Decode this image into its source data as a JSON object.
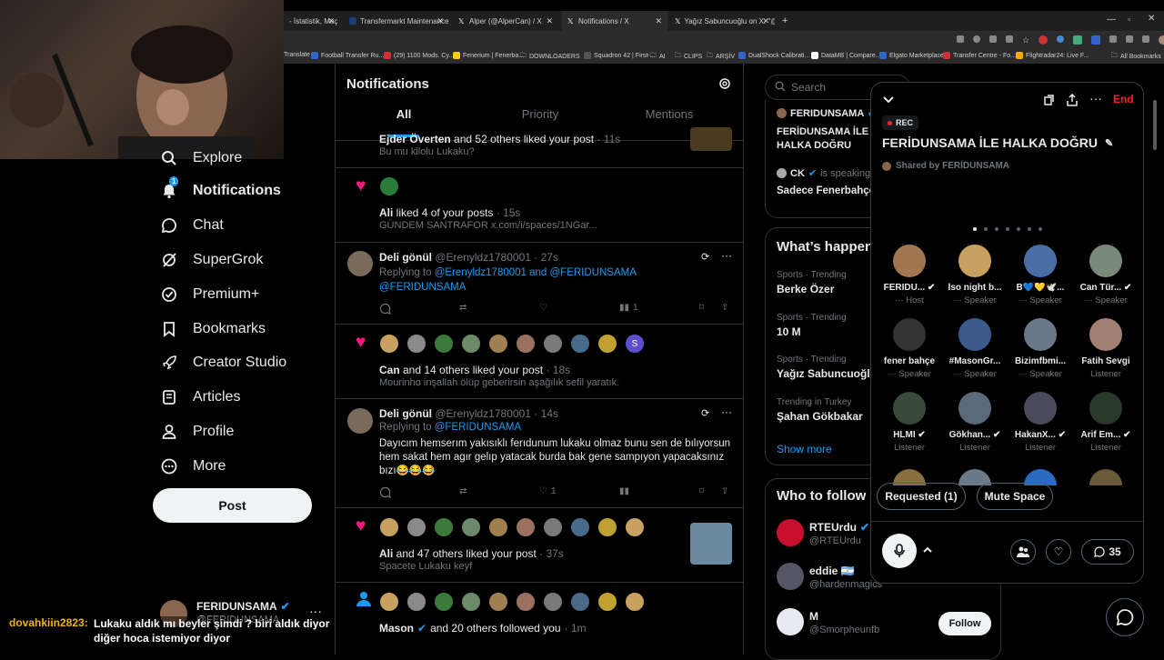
{
  "browser": {
    "tabs": [
      {
        "label": "- İstatistik, Maç",
        "color": "#e44"
      },
      {
        "label": "Transfermarkt Maintenance",
        "color": "#1a3d7c"
      },
      {
        "label": "Alper (@AlperCan) / X",
        "color": "#fff"
      },
      {
        "label": "Notifications / X",
        "color": "#fff"
      },
      {
        "label": "Yağız Sabuncuoğlu on X: \"@Be",
        "color": "#fff"
      }
    ],
    "bookmarks": [
      "Translate",
      "Football Transfer Ru...",
      "(29) 1100 Mods. Cy...",
      "Fenerium | Fenerba...",
      "DOWNLOADERS",
      "Squadron 42 | First-...",
      "AI",
      "CLIPS",
      "ARŞİV",
      "DualShock Calibrati...",
      "DataMB | Compare...",
      "Elgato Marketplace",
      "Transfer Centre - Fo...",
      "Flightradar24: Live F...",
      "All Bookmarks"
    ]
  },
  "nav": {
    "items": [
      {
        "label": "Explore",
        "icon": "search-icon"
      },
      {
        "label": "Notifications",
        "icon": "bell-icon",
        "badge": "1"
      },
      {
        "label": "Chat",
        "icon": "chat-icon"
      },
      {
        "label": "SuperGrok",
        "icon": "grok-icon"
      },
      {
        "label": "Premium+",
        "icon": "premium-icon"
      },
      {
        "label": "Bookmarks",
        "icon": "bookmark-icon"
      },
      {
        "label": "Creator Studio",
        "icon": "rocket-icon"
      },
      {
        "label": "Articles",
        "icon": "articles-icon"
      },
      {
        "label": "Profile",
        "icon": "person-icon"
      },
      {
        "label": "More",
        "icon": "more-icon"
      }
    ],
    "post": "Post",
    "account_name": "FERIDUNSAMA",
    "account_handle": "@FERIDUNSAMA"
  },
  "header": {
    "title": "Notifications",
    "tabs": [
      "All",
      "Priority",
      "Mentions"
    ]
  },
  "notifications": [
    {
      "type": "like",
      "actor": "Ejder Överten",
      "text": " and 52 others liked your post",
      "time": " · 11s",
      "body": "Bu mu kilolu Lukaku?"
    },
    {
      "type": "like",
      "actor": "Ali",
      "text": " liked 4 of your posts",
      "time": " · 15s",
      "body": "GÜNDEM SANTRAFOR x.com/i/spaces/1NGar..."
    },
    {
      "type": "reply",
      "name": "Deli gönül",
      "handle": "@Erenyldz1780001",
      "time": " · 27s",
      "replying": "Replying to ",
      "reply_to": "@Erenyldz1780001 and @FERIDUNSAMA",
      "reply_to2": "@FERIDUNSAMA",
      "views": "1"
    },
    {
      "type": "like",
      "actor": "Can",
      "text": " and 14 others liked your post",
      "time": " · 18s",
      "body": "Mourinho inşallah ölüp geberirsin aşağılık sefil yaratık.",
      "avatar_letter": "S"
    },
    {
      "type": "reply",
      "name": "Deli gönül",
      "handle": "@Erenyldz1780001",
      "time": " · 14s",
      "replying": "Replying to ",
      "reply_to": "@FERIDUNSAMA",
      "body": "Dayıcım hemserım yakısıklı ferıdunum lukaku olmaz bunu sen de bılıyorsun hem sakat hem agır gelıp yatacak burda bak gene sampıyon yapacaksınız bızı😂😂😂",
      "likes": "1"
    },
    {
      "type": "like",
      "actor": "Ali",
      "text": " and 47 others liked your post",
      "time": " · 37s",
      "body": "Spacete Lukaku keyf"
    },
    {
      "type": "follow",
      "actor": "Mason",
      "text": " and 20 others followed you",
      "time": " · 1m"
    }
  ],
  "right": {
    "search_placeholder": "Search",
    "space_card": {
      "host": "FERIDUNSAMA",
      "title": "FERİDUNSAMA İLE HALKA DOĞRU",
      "speaker": "CK",
      "speaking": "is speaking",
      "speaker_title": "Sadece Fenerbahçe"
    },
    "trends_title": "What’s happening",
    "trends": [
      {
        "meta": "Sports · Trending",
        "name": "Berke Özer"
      },
      {
        "meta": "Sports · Trending",
        "name": "10 M"
      },
      {
        "meta": "Sports · Trending",
        "name": "Yağız Sabuncuoğlu"
      },
      {
        "meta": "Trending in Turkey",
        "name": "Şahan Gökbakar"
      }
    ],
    "show_more": "Show more",
    "who_to_follow": "Who to follow",
    "follow": [
      {
        "name": "RTEUrdu",
        "handle": "@RTEUrdu"
      },
      {
        "name": "eddie 🇦🇷",
        "handle": "@hardenmagics"
      },
      {
        "name": "M",
        "handle": "@Smorpheunfb",
        "button": "Follow"
      }
    ]
  },
  "space": {
    "rec": "REC",
    "title": "FERİDUNSAMA İLE HALKA DOĞRU",
    "shared": "Shared by FERİDUNSAMA",
    "end": "End",
    "people": [
      {
        "name": "FERIDU...",
        "role": "Host",
        "verified": true,
        "color": "#a0764e"
      },
      {
        "name": "İso night b...",
        "role": "Speaker",
        "color": "#c8a060"
      },
      {
        "name": "B💙💛🕊️...",
        "role": "Speaker",
        "color": "#4a6fa5"
      },
      {
        "name": "Can Tür...",
        "role": "Speaker",
        "verified": true,
        "color": "#7a8a7a"
      },
      {
        "name": "fener bahçe",
        "role": "Speaker",
        "color": "#333"
      },
      {
        "name": "#MasonGr...",
        "role": "Speaker",
        "color": "#3a5a8a"
      },
      {
        "name": "Bizimfbmi...",
        "role": "Speaker",
        "color": "#6a7a8a"
      },
      {
        "name": "Fatih Sevgi",
        "role": "Listener",
        "color": "#a08070"
      },
      {
        "name": "HLMI",
        "role": "Listener",
        "verified": true,
        "color": "#3a4a3a"
      },
      {
        "name": "Gökhan...",
        "role": "Listener",
        "verified": true,
        "color": "#5a6a7a"
      },
      {
        "name": "HakanX...",
        "role": "Listener",
        "verified": true,
        "color": "#4a4a5a"
      },
      {
        "name": "Arif Em...",
        "role": "Listener",
        "verified": true,
        "color": "#2a3a2a"
      }
    ],
    "requested": "Requested (1)",
    "mute": "Mute Space",
    "comments": "35"
  },
  "stream_chat": {
    "user": "dovahkiin2823:",
    "message": "Lukaku aldık mı beyler şimdi ? biri aldık diyor diğer hoca istemiyor diyor"
  }
}
